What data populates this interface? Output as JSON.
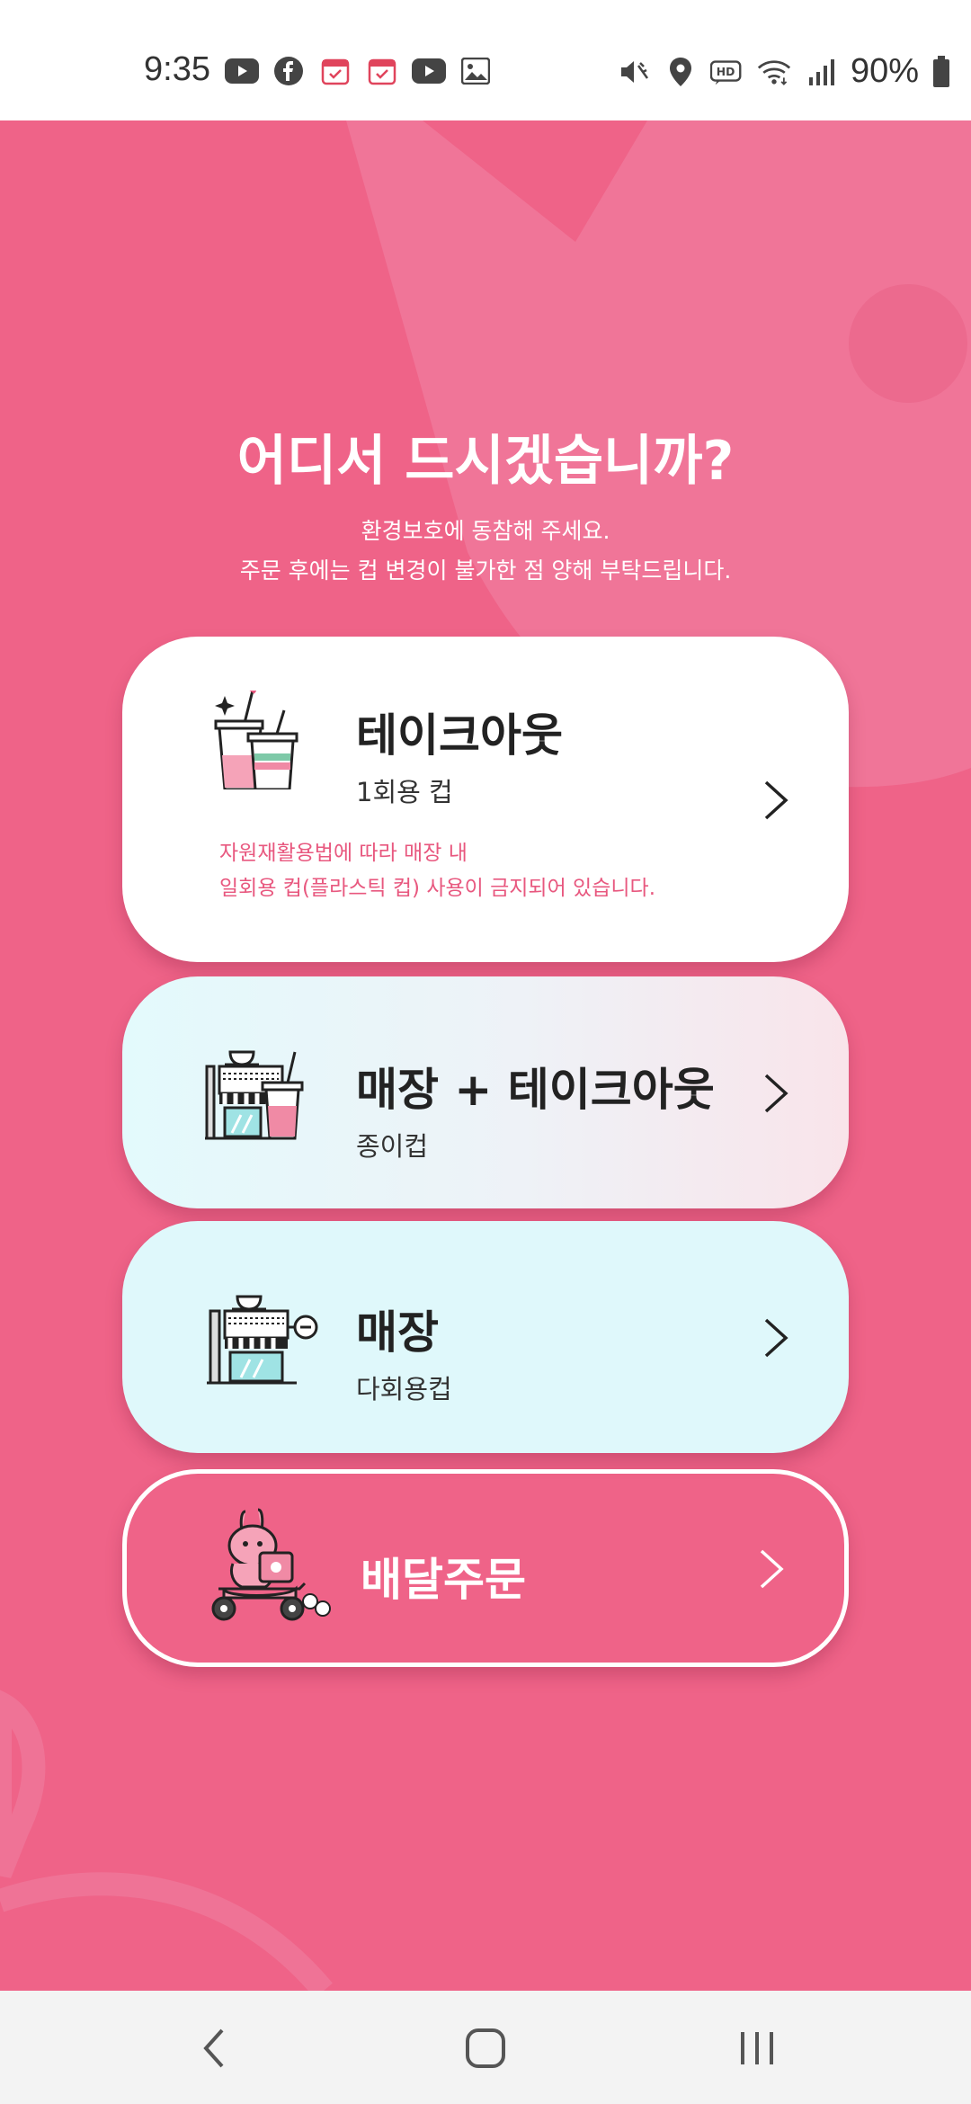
{
  "status_bar": {
    "time": "9:35",
    "battery": "90%",
    "left_icons": [
      "youtube-icon",
      "facebook-icon",
      "calendar-check-icon",
      "calendar-check-icon",
      "youtube-icon",
      "gallery-icon"
    ],
    "right_icons": [
      "mute-icon",
      "location-icon",
      "hd-icon",
      "wifi-icon",
      "signal-icon",
      "battery-icon"
    ]
  },
  "header": {
    "title": "어디서 드시겠습니까?",
    "subtitle_line1": "환경보호에 동참해 주세요.",
    "subtitle_line2": "주문 후에는 컵 변경이 불가한 점 양해 부탁드립니다."
  },
  "options": [
    {
      "title": "테이크아웃",
      "subtitle": "1회용 컵",
      "note_line1": "자원재활용법에 따라 매장 내",
      "note_line2": "일회용 컵(플라스틱 컵) 사용이 금지되어 있습니다.",
      "icon": "takeout-cups-icon"
    },
    {
      "title": "매장 + 테이크아웃",
      "subtitle": "종이컵",
      "icon": "store-and-cup-icon"
    },
    {
      "title": "매장",
      "subtitle": "다회용컵",
      "icon": "store-icon"
    },
    {
      "title": "배달주문",
      "icon": "delivery-rabbit-scooter-icon"
    }
  ],
  "colors": {
    "primary_pink": "#ef6388",
    "note_pink": "#e8587f",
    "card_white": "#ffffff",
    "card_mint": "#dff8fb"
  },
  "nav_bar": {
    "buttons": [
      "back-icon",
      "home-icon",
      "recents-icon"
    ]
  }
}
